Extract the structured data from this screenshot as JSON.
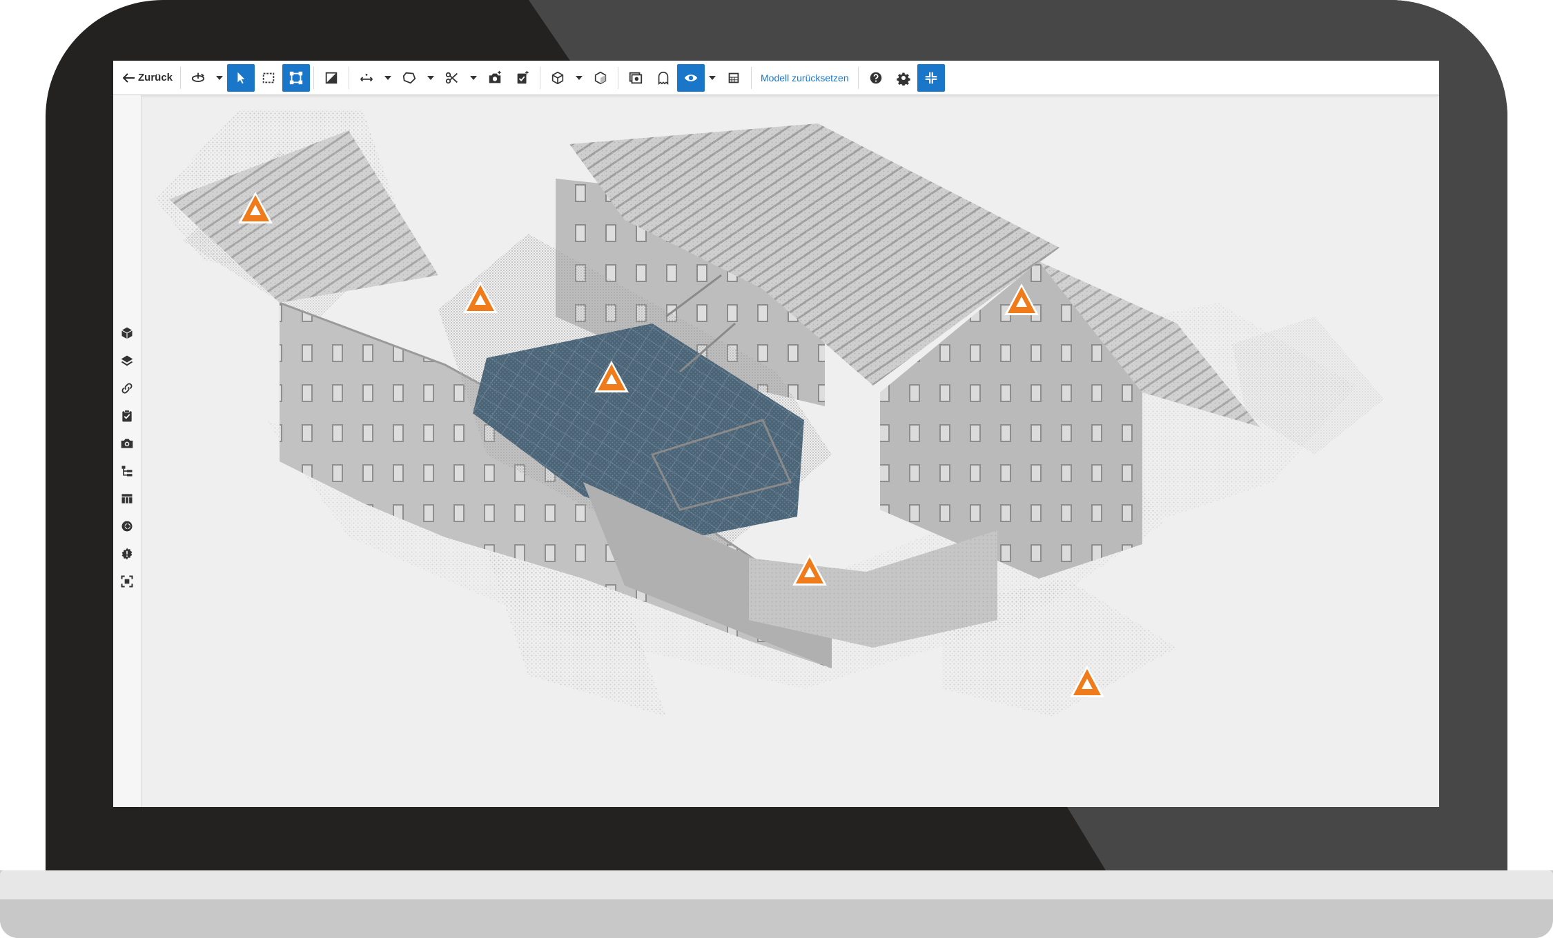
{
  "toolbar": {
    "back_label": "Zurück",
    "reset_label": "Modell zurücksetzen"
  },
  "colors": {
    "accent": "#1976c9",
    "marker_orange": "#f07b1a",
    "solar_panel": "#4a6478",
    "laptop_dark": "#232221",
    "laptop_gray": "#484748"
  },
  "side_icons": [
    "cube-icon",
    "layers-icon",
    "link-icon",
    "clipboard-check-icon",
    "camera-icon",
    "tree-icon",
    "table-icon",
    "globe-icon",
    "badge-icon",
    "focus-icon"
  ],
  "markers": [
    "viewpoint-marker-1",
    "viewpoint-marker-2",
    "viewpoint-marker-3",
    "viewpoint-marker-4",
    "viewpoint-marker-5",
    "viewpoint-marker-6"
  ]
}
